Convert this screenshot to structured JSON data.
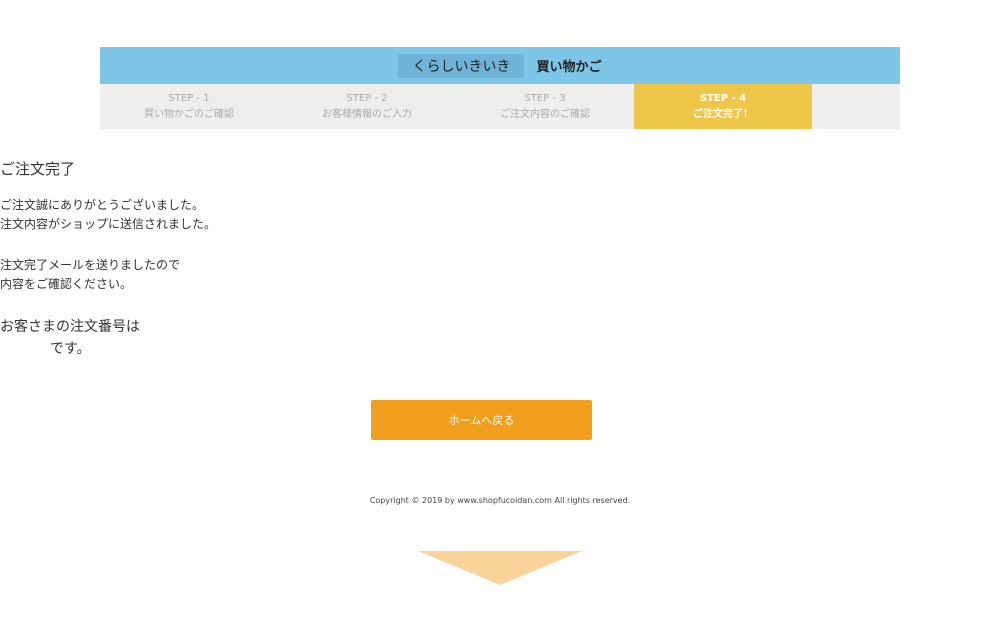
{
  "header": {
    "shop_name": "くらしいきいき",
    "title": "買い物かご"
  },
  "steps": [
    {
      "num": "STEP - 1",
      "label": "買い物かごのご確認",
      "active": false
    },
    {
      "num": "STEP - 2",
      "label": "お客様情報のご入力",
      "active": false
    },
    {
      "num": "STEP - 3",
      "label": "ご注文内容のご確認",
      "active": false
    },
    {
      "num": "STEP - 4",
      "label": "ご注文完了！",
      "active": true
    }
  ],
  "main": {
    "title": "ご注文完了",
    "para1_line1": "ご注文誠にありがとうございました。",
    "para1_line2": "注文内容がショップに送信されました。",
    "para2_line1": "注文完了メールを送りましたので",
    "para2_line2": "内容をご確認ください。",
    "order_line1": "お客さまの注文番号は",
    "order_line2": "です。",
    "home_button": "ホームへ戻る"
  },
  "footer": {
    "copyright": "Copyright © 2019 by www.shopfucoidan.com All rights reserved."
  },
  "colors": {
    "header": "#7ec6e8",
    "active_step": "#eec64a",
    "button": "#f19f1f",
    "arrow": "#f8d49a"
  }
}
